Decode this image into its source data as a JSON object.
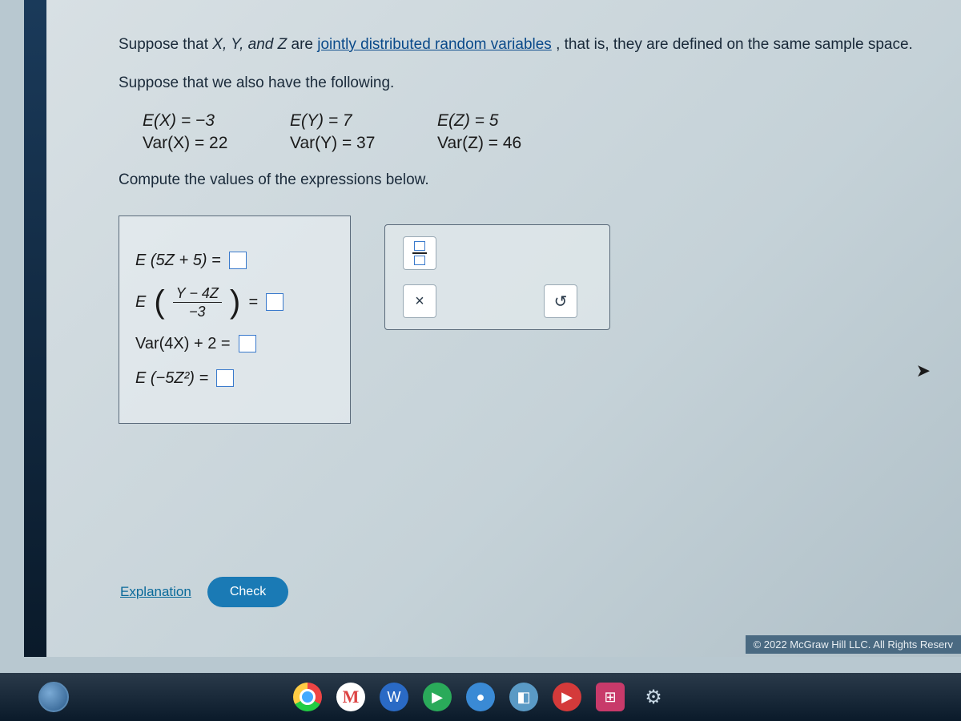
{
  "problem": {
    "intro_prefix": "Suppose that ",
    "intro_vars": "X, Y, and Z",
    "intro_mid": " are ",
    "link_text": "jointly distributed random variables",
    "intro_suffix": ", that is, they are defined on the same sample space.",
    "line2": "Suppose that we also have the following.",
    "given": {
      "ex": "E(X) = −3",
      "ey": "E(Y) = 7",
      "ez": "E(Z) = 5",
      "vx": "Var(X) = 22",
      "vy": "Var(Y) = 37",
      "vz": "Var(Z) = 46"
    },
    "compute": "Compute the values of the expressions below."
  },
  "answers": {
    "r1": "E (5Z + 5) =",
    "r2_E": "E",
    "r2_num": "Y − 4Z",
    "r2_den": "−3",
    "r2_eq": "=",
    "r3": "Var(4X) + 2 =",
    "r4": "E (−5Z²) ="
  },
  "tools": {
    "clear": "×",
    "reset": "↺"
  },
  "actions": {
    "explanation": "Explanation",
    "check": "Check"
  },
  "footer": {
    "copyright": "© 2022 McGraw Hill LLC. All Rights Reserv"
  },
  "taskbar": {
    "gmail": "M",
    "word": "W",
    "play": "▶",
    "blue": "●",
    "cam": "◧",
    "yt": "▶",
    "grid": "⊞",
    "gear": "⚙"
  }
}
